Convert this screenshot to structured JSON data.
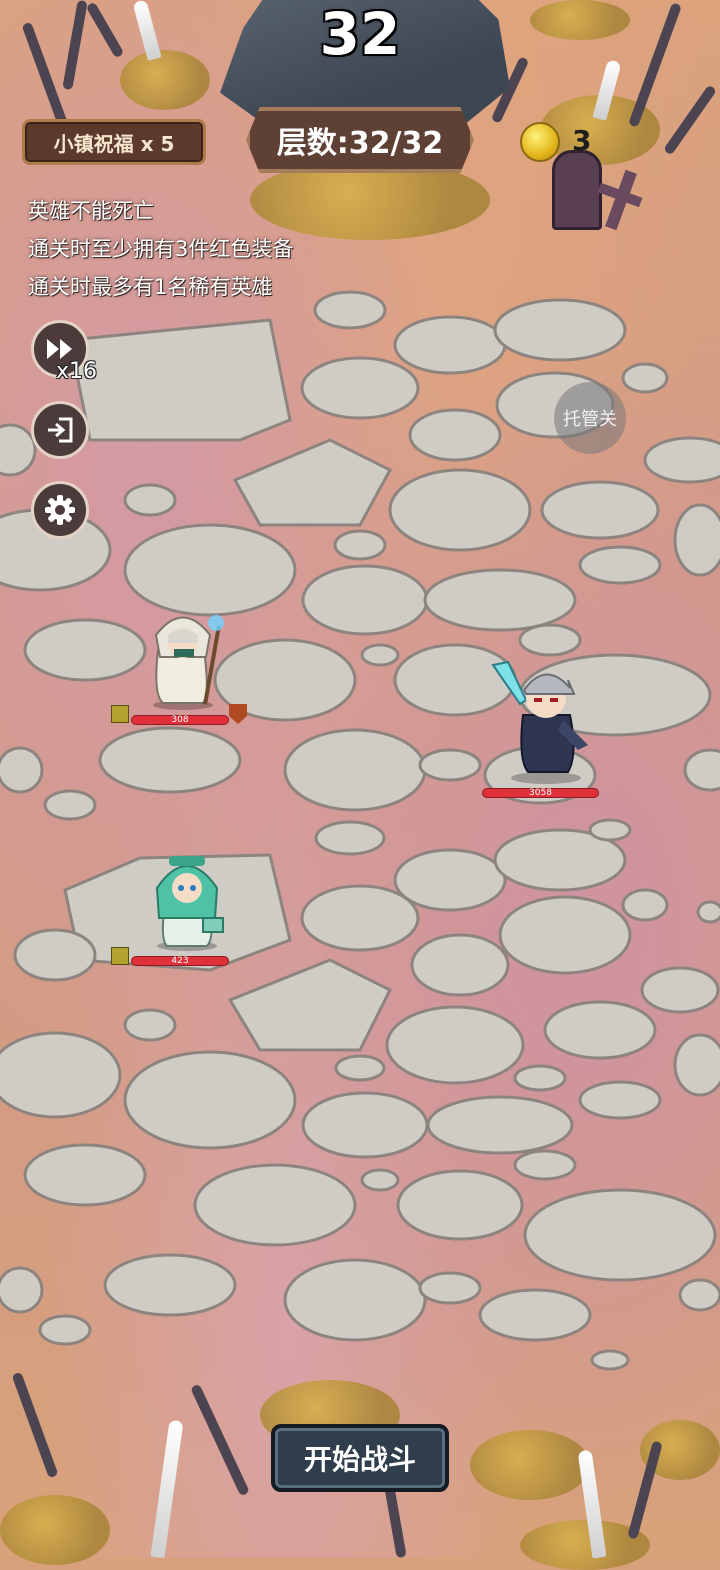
{
  "level": {
    "number": "32"
  },
  "blessing": {
    "label": "小镇祝福 x 5"
  },
  "floor": {
    "label": "层数:32/32"
  },
  "currency": {
    "icon": "gold-coin-icon",
    "count": "3"
  },
  "rules": [
    "英雄不能死亡",
    "通关时至少拥有3件红色装备",
    "通关时最多有1名稀有英雄"
  ],
  "controls": {
    "fast_forward_icon": "fast-forward-icon",
    "speed_label": "x16",
    "exit_icon": "exit-icon",
    "settings_icon": "gear-icon",
    "auto_label": "托管关"
  },
  "units": [
    {
      "name": "white-hooded-mage",
      "hp": "308",
      "hp_fraction": 1.0,
      "side": "ally"
    },
    {
      "name": "silver-haired-swordsman",
      "hp": "3058",
      "hp_fraction": 1.0,
      "side": "enemy"
    },
    {
      "name": "green-haired-priestess",
      "hp": "423",
      "hp_fraction": 1.0,
      "side": "ally"
    }
  ],
  "start_button": {
    "label": "开始战斗"
  },
  "colors": {
    "hp_bar": "#e0303a",
    "panel_brown": "#5b3a2b",
    "button_navy": "#2f3d4c"
  }
}
